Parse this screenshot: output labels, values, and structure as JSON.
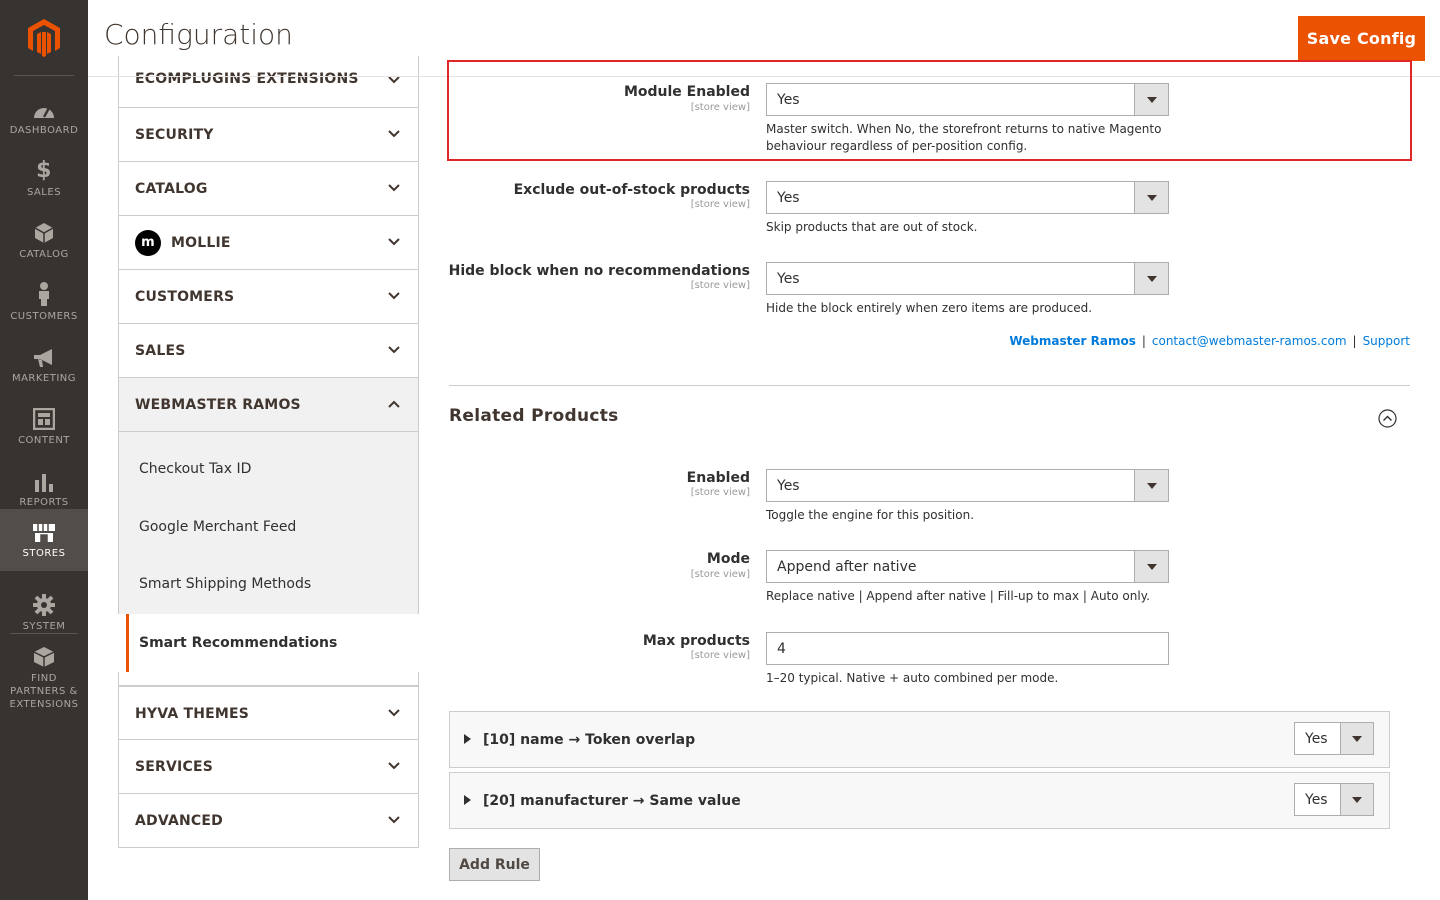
{
  "menu": {
    "items": [
      {
        "label": "DASHBOARD",
        "icon": "dashboard-icon"
      },
      {
        "label": "SALES",
        "icon": "dollar-icon"
      },
      {
        "label": "CATALOG",
        "icon": "box-icon"
      },
      {
        "label": "CUSTOMERS",
        "icon": "person-icon"
      },
      {
        "label": "MARKETING",
        "icon": "megaphone-icon"
      },
      {
        "label": "CONTENT",
        "icon": "layout-icon"
      },
      {
        "label": "REPORTS",
        "icon": "bar-chart-icon"
      },
      {
        "label": "STORES",
        "icon": "store-icon"
      },
      {
        "label": "SYSTEM",
        "icon": "gear-icon"
      },
      {
        "label": "FIND PARTNERS & EXTENSIONS",
        "icon": "extensions-icon"
      }
    ],
    "active": "STORES"
  },
  "header": {
    "title": "Configuration",
    "save_label": "Save Config"
  },
  "tabs": {
    "items": [
      "ECOMPLUGINS EXTENSIONS",
      "SECURITY",
      "CATALOG",
      "MOLLIE",
      "CUSTOMERS",
      "SALES",
      "WEBMASTER RAMOS",
      "HYVA THEMES",
      "SERVICES",
      "ADVANCED"
    ],
    "mollie_badge": "m",
    "sub_items": [
      "Checkout Tax ID",
      "Google Merchant Feed",
      "Smart Shipping Methods",
      "Smart Recommendations"
    ],
    "active_sub": "Smart Recommendations"
  },
  "general": {
    "module_enabled": {
      "label": "Module Enabled",
      "scope": "[store view]",
      "value": "Yes",
      "note": "Master switch. When No, the storefront returns to native Magento behaviour regardless of per-position config."
    },
    "exclude_oos": {
      "label": "Exclude out-of-stock products",
      "scope": "[store view]",
      "value": "Yes",
      "note": "Skip products that are out of stock."
    },
    "hide_block": {
      "label": "Hide block when no recommendations",
      "scope": "[store view]",
      "value": "Yes",
      "note": "Hide the block entirely when zero items are produced."
    }
  },
  "links": {
    "vendor": "Webmaster Ramos",
    "email": "contact@webmaster-ramos.com",
    "support": "Support",
    "separator": "|"
  },
  "related": {
    "title": "Related Products",
    "enabled": {
      "label": "Enabled",
      "scope": "[store view]",
      "value": "Yes",
      "note": "Toggle the engine for this position."
    },
    "mode": {
      "label": "Mode",
      "scope": "[store view]",
      "value": "Append after native",
      "note": "Replace native | Append after native | Fill-up to max | Auto only."
    },
    "max_products": {
      "label": "Max products",
      "scope": "[store view]",
      "value": "4",
      "note": "1–20 typical. Native + auto combined per mode."
    },
    "rules": [
      {
        "title": "[10] name → Token overlap",
        "value": "Yes"
      },
      {
        "title": "[20] manufacturer → Same value",
        "value": "Yes"
      }
    ],
    "add_rule_label": "Add Rule"
  },
  "colors": {
    "menu_bg": "#373330",
    "accent": "#eb5202",
    "highlight_border": "#e22626",
    "link": "#007bdb"
  }
}
